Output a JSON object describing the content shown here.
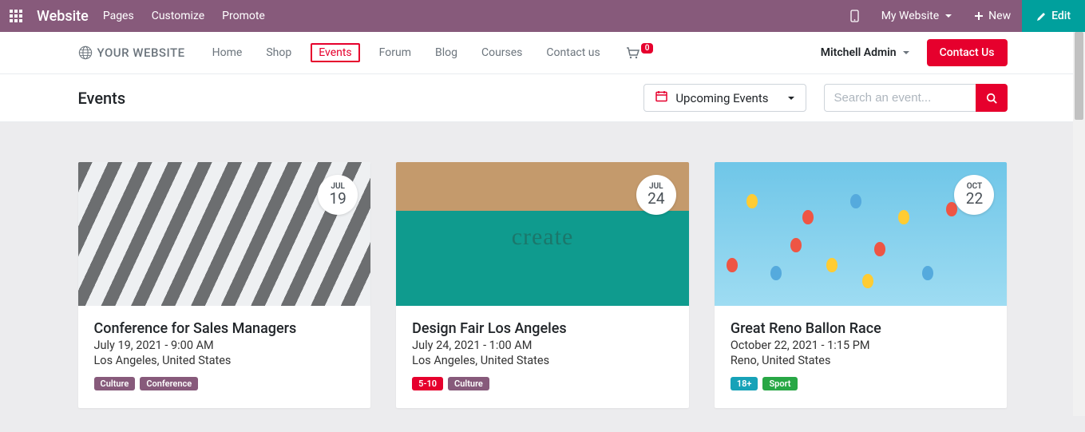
{
  "topbar": {
    "brand": "Website",
    "menu": [
      "Pages",
      "Customize",
      "Promote"
    ],
    "my_website": "My Website",
    "new": "New",
    "edit": "Edit"
  },
  "siteheader": {
    "logo_text": "YOUR WEBSITE",
    "nav": [
      "Home",
      "Shop",
      "Events",
      "Forum",
      "Blog",
      "Courses",
      "Contact us"
    ],
    "active_index": 2,
    "cart_count": "0",
    "user": "Mitchell Admin",
    "contact_btn": "Contact Us"
  },
  "subbar": {
    "title": "Events",
    "filter_label": "Upcoming Events",
    "search_placeholder": "Search an event..."
  },
  "events": [
    {
      "badge_month": "JUL",
      "badge_day": "19",
      "title": "Conference for Sales Managers",
      "date": "July 19, 2021 - 9:00 AM",
      "location": "Los Angeles, United States",
      "tags": [
        {
          "text": "Culture",
          "cls": "purple"
        },
        {
          "text": "Conference",
          "cls": "purple"
        }
      ],
      "img": "img1"
    },
    {
      "badge_month": "JUL",
      "badge_day": "24",
      "title": "Design Fair Los Angeles",
      "date": "July 24, 2021 - 1:00 AM",
      "location": "Los Angeles, United States",
      "tags": [
        {
          "text": "5-10",
          "cls": "red"
        },
        {
          "text": "Culture",
          "cls": "purple"
        }
      ],
      "img": "img2"
    },
    {
      "badge_month": "OCT",
      "badge_day": "22",
      "title": "Great Reno Ballon Race",
      "date": "October 22, 2021 - 1:15 PM",
      "location": "Reno, United States",
      "tags": [
        {
          "text": "18+",
          "cls": "blue"
        },
        {
          "text": "Sport",
          "cls": "green"
        }
      ],
      "img": "img3"
    }
  ]
}
